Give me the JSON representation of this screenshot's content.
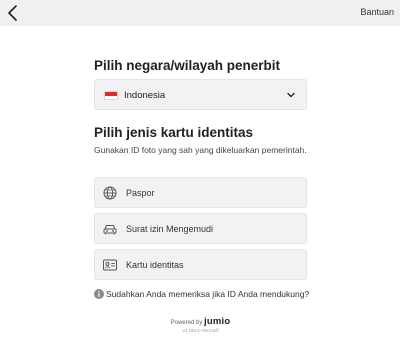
{
  "header": {
    "back_icon": "chevron-left-icon",
    "help_label": "Bantuan"
  },
  "country": {
    "heading": "Pilih negara/wilayah penerbit",
    "selected": "Indonesia",
    "flag_icon": "indonesia-flag-icon",
    "flag_colors": [
      "#e12b2b",
      "#ffffff"
    ],
    "dropdown_icon": "chevron-down-icon"
  },
  "id_type": {
    "heading": "Pilih jenis kartu identitas",
    "description": "Gunakan ID foto yang sah yang dikeluarkan pemerintah.",
    "options": [
      {
        "label": "Paspor",
        "icon": "globe-icon"
      },
      {
        "label": "Surat izin Mengemudi",
        "icon": "car-icon"
      },
      {
        "label": "Kartu identitas",
        "icon": "id-card-icon"
      }
    ]
  },
  "support": {
    "question": "Sudahkan Anda memeriksa jika ID Anda mendukung?",
    "icon": "info-icon"
  },
  "footer": {
    "powered_by": "Powered by",
    "brand": "jumio",
    "version": "v4.159.2-79210eff"
  }
}
